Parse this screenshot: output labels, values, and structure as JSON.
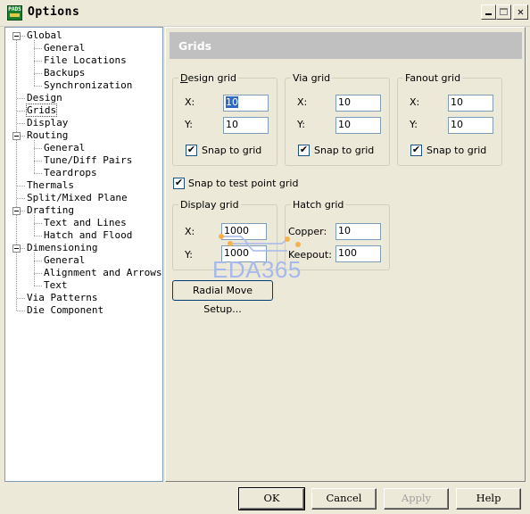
{
  "window": {
    "title": "Options",
    "icon_text": "PADS"
  },
  "tree": {
    "items": [
      {
        "label": "Global",
        "level": 0,
        "toggle": "minus"
      },
      {
        "label": "General",
        "level": 1
      },
      {
        "label": "File Locations",
        "level": 1
      },
      {
        "label": "Backups",
        "level": 1
      },
      {
        "label": "Synchronization",
        "level": 1
      },
      {
        "label": "Design",
        "level": 0
      },
      {
        "label": "Grids",
        "level": 0,
        "selected": true
      },
      {
        "label": "Display",
        "level": 0
      },
      {
        "label": "Routing",
        "level": 0,
        "toggle": "minus"
      },
      {
        "label": "General",
        "level": 1
      },
      {
        "label": "Tune/Diff Pairs",
        "level": 1
      },
      {
        "label": "Teardrops",
        "level": 1
      },
      {
        "label": "Thermals",
        "level": 0
      },
      {
        "label": "Split/Mixed Plane",
        "level": 0
      },
      {
        "label": "Drafting",
        "level": 0,
        "toggle": "minus"
      },
      {
        "label": "Text and Lines",
        "level": 1
      },
      {
        "label": "Hatch and Flood",
        "level": 1
      },
      {
        "label": "Dimensioning",
        "level": 0,
        "toggle": "minus"
      },
      {
        "label": "General",
        "level": 1
      },
      {
        "label": "Alignment and Arrows",
        "level": 1
      },
      {
        "label": "Text",
        "level": 1
      },
      {
        "label": "Via Patterns",
        "level": 0
      },
      {
        "label": "Die Component",
        "level": 0
      }
    ]
  },
  "panel": {
    "title": "Grids",
    "design_grid": {
      "legend": "Design grid",
      "x_label": "X:",
      "x_value": "10",
      "y_label": "Y:",
      "y_value": "10",
      "snap_label": "Snap to grid",
      "snap_checked": "✔"
    },
    "via_grid": {
      "legend": "Via grid",
      "x_label": "X:",
      "x_value": "10",
      "y_label": "Y:",
      "y_value": "10",
      "snap_label": "Snap to grid",
      "snap_checked": "✔"
    },
    "fanout_grid": {
      "legend": "Fanout grid",
      "x_label": "X:",
      "x_value": "10",
      "y_label": "Y:",
      "y_value": "10",
      "snap_label": "Snap to grid",
      "snap_checked": "✔"
    },
    "snap_test_point": {
      "label": "Snap to test point grid",
      "checked": "✔"
    },
    "display_grid": {
      "legend": "Display grid",
      "x_label": "X:",
      "x_value": "1000",
      "y_label": "Y:",
      "y_value": "1000"
    },
    "hatch_grid": {
      "legend": "Hatch grid",
      "copper_label": "Copper:",
      "copper_value": "10",
      "keepout_label": "Keepout:",
      "keepout_value": "100"
    },
    "radial_button": "Radial Move Setup..."
  },
  "watermark": {
    "text": "EDA365",
    "color": "#a6b8ec",
    "accent": "#f5b14c"
  },
  "buttons": {
    "ok": "OK",
    "cancel": "Cancel",
    "apply": "Apply",
    "help": "Help"
  }
}
